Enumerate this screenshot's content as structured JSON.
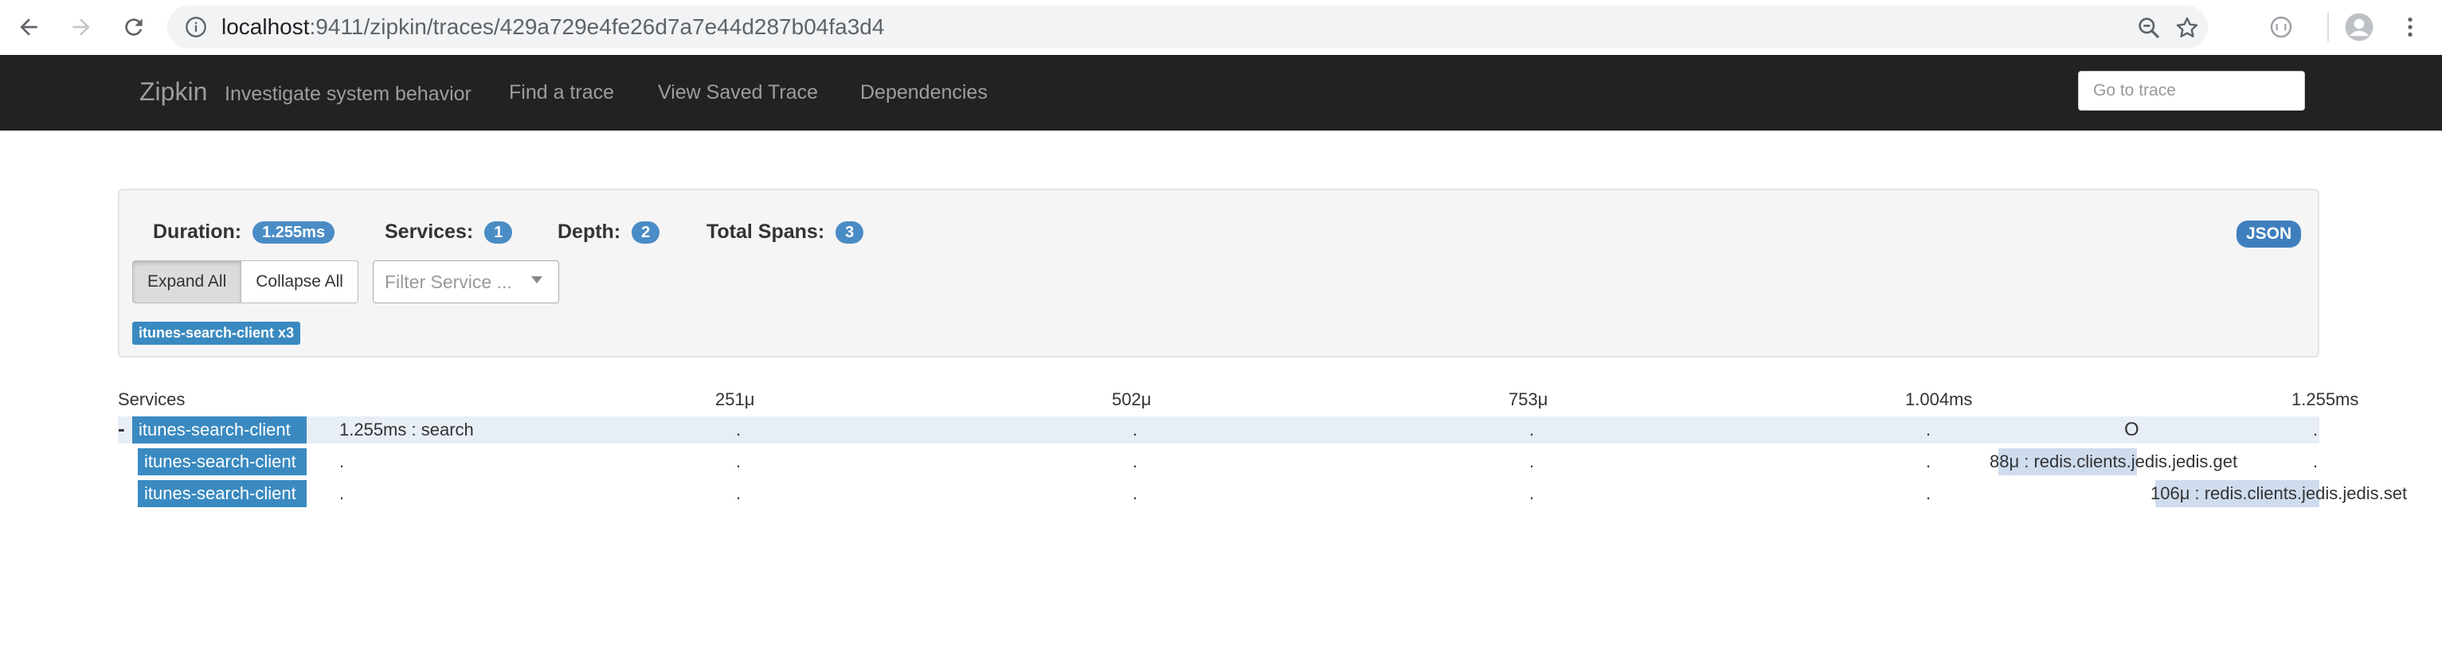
{
  "browser": {
    "url_host": "localhost",
    "url_path": ":9411/zipkin/traces/429a729e4fe26d7a7e44d287b04fa3d4"
  },
  "navbar": {
    "brand": "Zipkin",
    "tagline": "Investigate system behavior",
    "links": [
      "Find a trace",
      "View Saved Trace",
      "Dependencies"
    ],
    "goto_placeholder": "Go to trace"
  },
  "summary": {
    "duration_label": "Duration:",
    "duration_value": "1.255ms",
    "services_label": "Services:",
    "services_value": "1",
    "depth_label": "Depth:",
    "depth_value": "2",
    "spans_label": "Total Spans:",
    "spans_value": "3",
    "json_label": "JSON",
    "expand_all": "Expand All",
    "collapse_all": "Collapse All",
    "filter_placeholder": "Filter Service ...",
    "service_tag": "itunes-search-client x3"
  },
  "timeline": {
    "services_header": "Services",
    "ticks": [
      "251μ",
      "502μ",
      "753μ",
      "1.004ms",
      "1.255ms"
    ],
    "rows": [
      {
        "toggle": "-",
        "service": "itunes-search-client",
        "span": "1.255ms : search",
        "marker": "O",
        "start": 0.0,
        "fraction": 1.0
      },
      {
        "toggle": "",
        "service": "itunes-search-client",
        "span": "88μ : redis.clients.jedis.jedis.get",
        "marker": "",
        "start": 0.838,
        "fraction": 0.07
      },
      {
        "toggle": "",
        "service": "itunes-search-client",
        "span": "106μ : redis.clients.jedis.jedis.set",
        "marker": "",
        "start": 0.917,
        "fraction": 0.084
      }
    ]
  },
  "colors": {
    "navbar_bg": "#222222",
    "service_label": "#3a8ac1",
    "badge": "#4a8cc5",
    "span_bar": "#cfdcee"
  }
}
